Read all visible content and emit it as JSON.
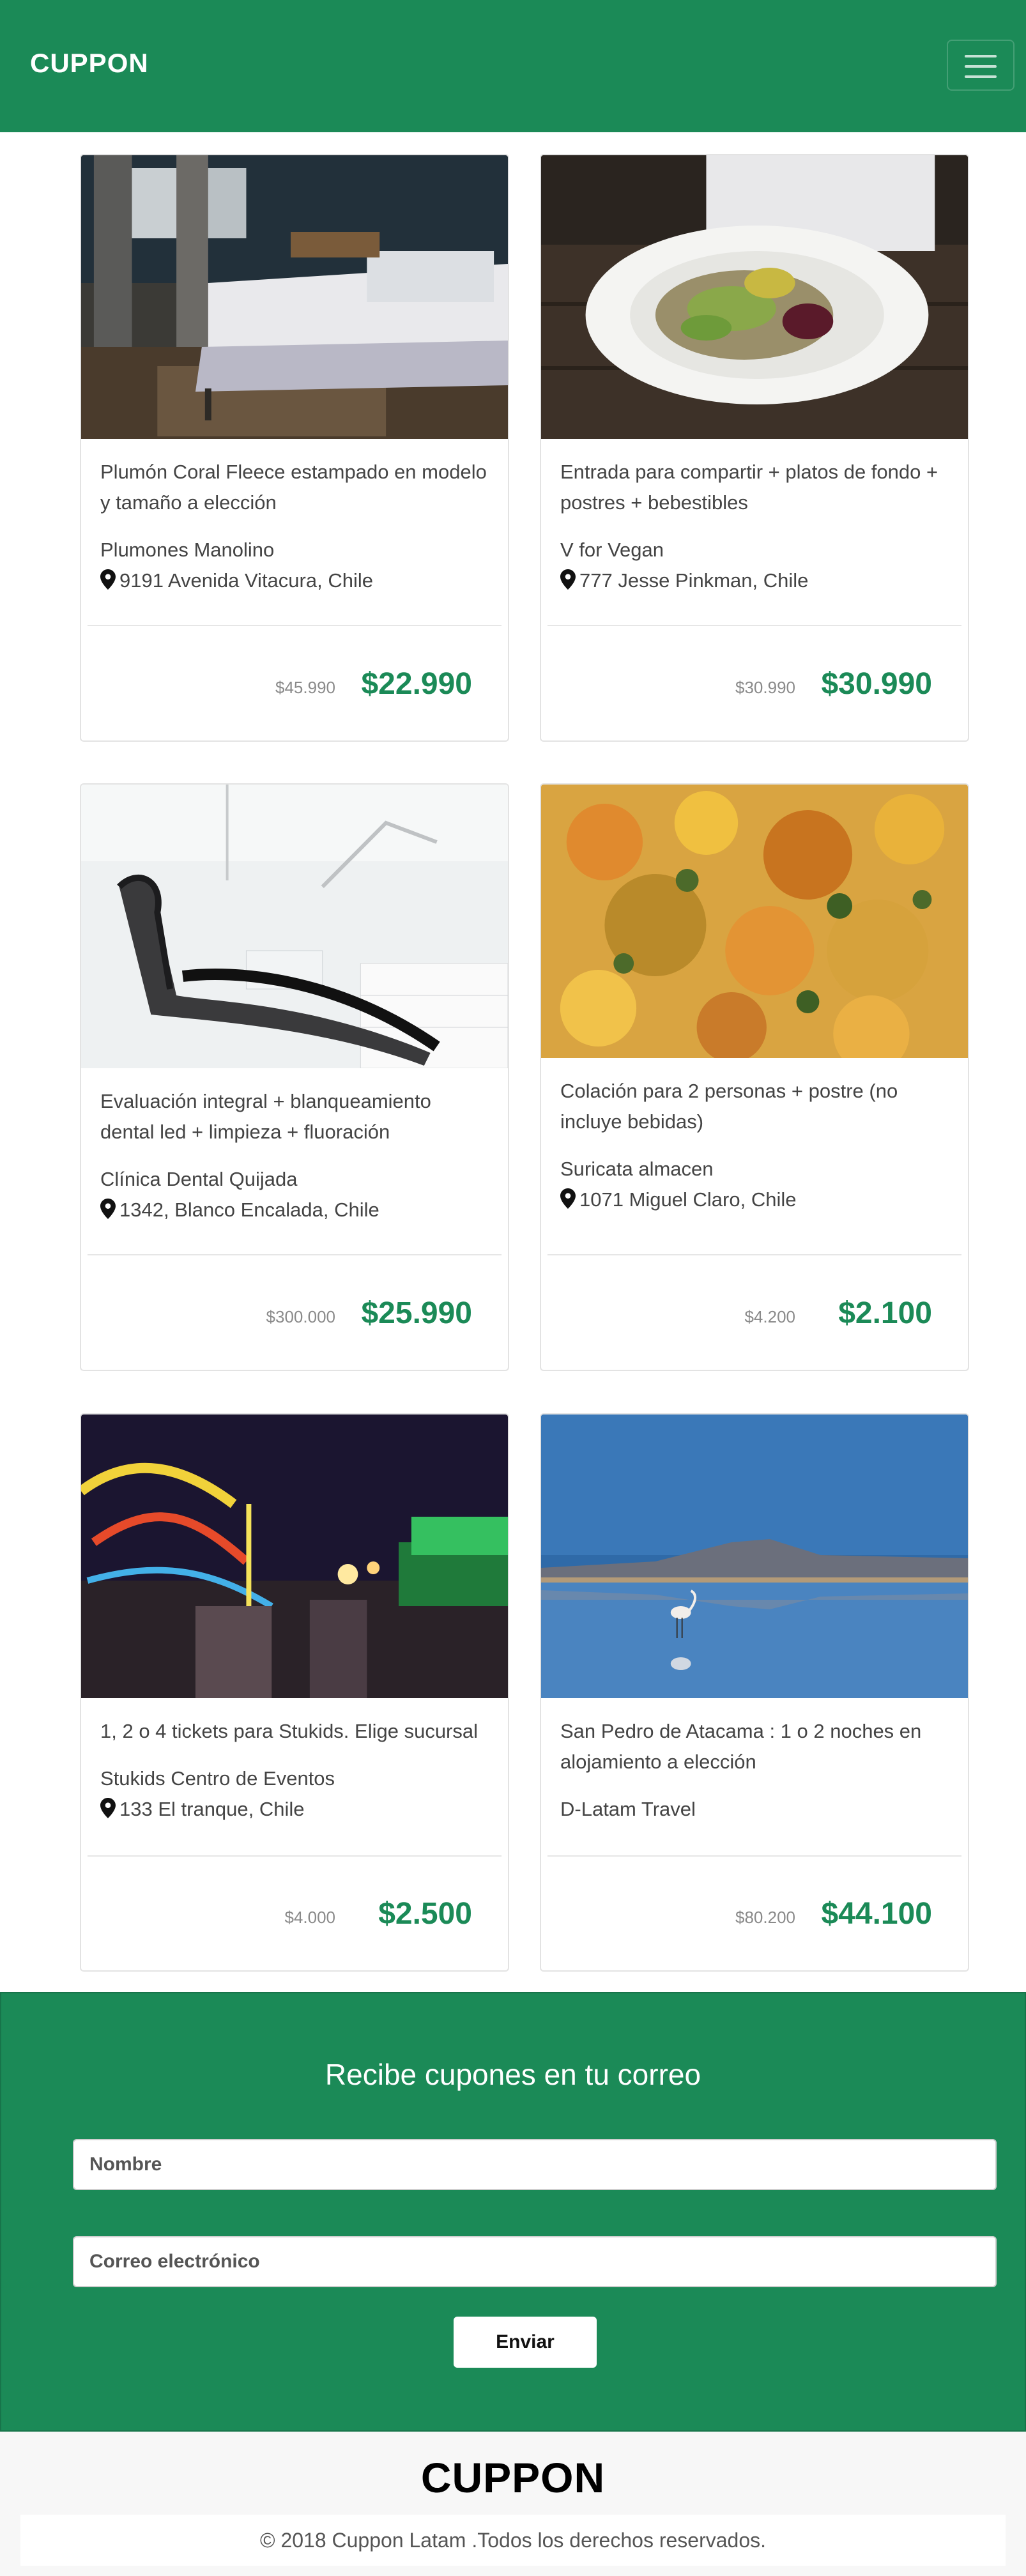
{
  "navbar": {
    "brand": "CUPPON",
    "menu_icon": "hamburger-menu-icon"
  },
  "deals": [
    {
      "title": "Plumón Coral Fleece estampado en modelo y tamaño a elección",
      "merchant": "Plumones Manolino",
      "address": "9191 Avenida Vitacura, Chile",
      "old_price": "$45.990",
      "price": "$22.990",
      "image": "bedroom-photo"
    },
    {
      "title": "Entrada para compartir + platos de fondo + postres + bebestibles",
      "merchant": "V for Vegan",
      "address": "777 Jesse Pinkman, Chile",
      "old_price": "$30.990",
      "price": "$30.990",
      "image": "vegan-plate-photo"
    },
    {
      "title": "Evaluación integral + blanqueamiento dental led + limpieza + fluoración",
      "merchant": "Clínica Dental Quijada",
      "address": "1342, Blanco Encalada, Chile",
      "old_price": "$300.000",
      "price": "$25.990",
      "image": "dental-chair-photo"
    },
    {
      "title": "Colación para 2 personas + postre (no incluye bebidas)",
      "merchant": "Suricata almacen",
      "address": "1071 Miguel Claro, Chile",
      "old_price": "$4.200",
      "price": "$2.100",
      "image": "food-closeup-photo"
    },
    {
      "title": "1, 2 o 4 tickets para Stukids. Elige sucursal",
      "merchant": "Stukids Centro de Eventos",
      "address": "133 El tranque, Chile",
      "old_price": "$4.000",
      "price": "$2.500",
      "image": "amusement-park-photo"
    },
    {
      "title": "San Pedro de Atacama : 1 o 2 noches en alojamiento a elección",
      "merchant": "D-Latam Travel",
      "address": "",
      "old_price": "$80.200",
      "price": "$44.100",
      "image": "flamingo-lagoon-photo"
    }
  ],
  "newsletter": {
    "title": "Recibe cupones en tu correo",
    "name_placeholder": "Nombre",
    "email_placeholder": "Correo electrónico",
    "button": "Enviar"
  },
  "footer": {
    "brand": "CUPPON",
    "copyright": "© 2018 Cuppon Latam .Todos los derechos reservados."
  },
  "colors": {
    "brand_green": "#1b8a57",
    "price_green": "#1b8a57"
  }
}
